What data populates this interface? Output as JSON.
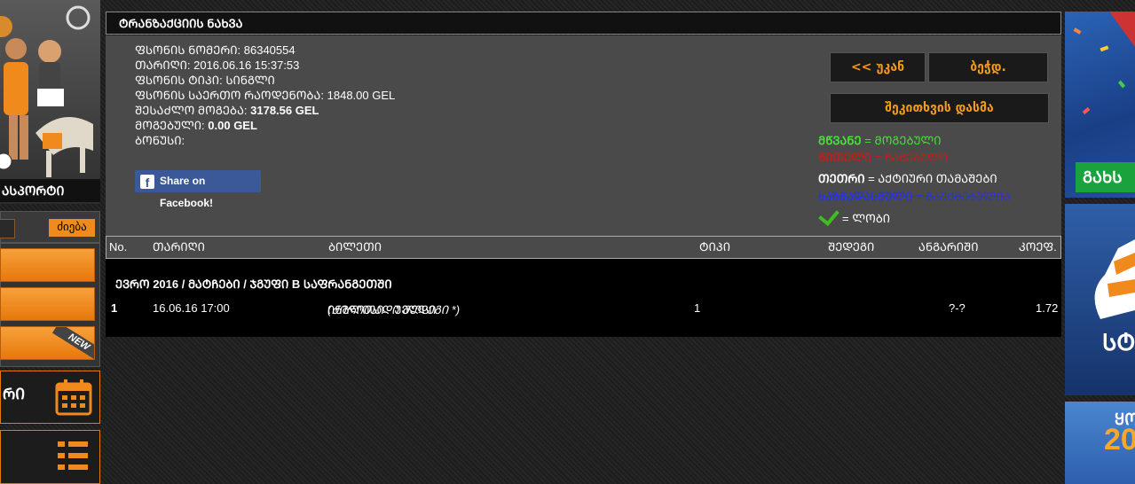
{
  "sidebar": {
    "sport_label": "ᲡᲞᲝᲠᲢᲘ",
    "sport_label_visible": "ᲐᲡᲞᲝᲠᲢᲘ",
    "search_button": "ძიება",
    "calendar_label": "ᲠᲘ",
    "new_badge": "NEW"
  },
  "panel": {
    "title": "ᲢᲠᲐᲜᲖᲐᲥᲪᲘᲘᲡ ᲜᲐᲮᲕᲐ",
    "info": {
      "ticket_number_label": "ᲤᲡᲝᲜᲘᲡ ᲜᲝᲛᲔᲠᲘ:",
      "ticket_number": "86340554",
      "date_label": "ᲗᲐᲠᲘᲦᲘ:",
      "date": "2016.06.16 15:37:53",
      "type_label": "ᲤᲡᲝᲜᲘᲡ ᲢᲘᲞᲘ:",
      "type": "ᲡᲘᲜᲒᲚᲘ",
      "total_label": "ᲤᲡᲝᲜᲘᲡ ᲡᲐᲔᲠᲗᲝ ᲠᲐᲝᲓᲔᲜᲝᲑᲐ:",
      "total": "1848.00 GEL",
      "possible_win_label": "ᲨᲔᲡᲐᲫᲚᲝ ᲛᲝᲒᲔᲑᲐ:",
      "possible_win": "3178.56 GEL",
      "won_label": "ᲛᲝᲒᲔᲑᲣᲚᲘ:",
      "won": "0.00 GEL",
      "bonus_label": "ᲑᲝᲜᲣᲡᲘ:"
    },
    "facebook_share": "Share on Facebook!",
    "back_button": "<< უკან",
    "print_button": "ბეჭდ.",
    "report_button": "შეკითხვის დასმა",
    "legend": [
      {
        "key": "ᲛᲬᲕᲐᲜᲔ",
        "value": "= ᲛᲝᲒᲔᲑᲣᲚᲘ",
        "color": "#4fdc3f"
      },
      {
        "key": "ᲬᲘᲗᲔᲚᲘ",
        "value": "= ᲬᲐᲒᲔᲑᲣᲚᲘ",
        "color": "#c21d1d"
      },
      {
        "key": "ᲗᲔᲗᲠᲘ",
        "value": "= ᲐᲥᲢᲘᲣᲠᲘ ᲗᲐᲛᲐᲨᲔᲑᲘ",
        "color": "#ffffff"
      },
      {
        "key": "ᲮᲐᲖᲒᲐᲓᲐᲡᲛᲣᲚᲘ",
        "value": "= ᲒᲐᲣᲥᲛᲔᲑᲣᲚᲘᲐ",
        "color": "#2a32e6"
      },
      {
        "key": "",
        "value": "= ᲚᲝᲑᲘ",
        "color": "#3dbf1f"
      }
    ],
    "table": {
      "headers": [
        "No.",
        "ᲗᲐᲠᲘᲦᲘ",
        "ᲑᲘᲚᲔᲗᲘ",
        "ᲢᲘᲞᲘ",
        "ᲨᲔᲓᲔᲒᲘ",
        "ᲐᲜᲒᲐᲠᲘᲨᲘ",
        "ᲙᲝᲔᲤ."
      ],
      "group": "ᲔᲕᲠᲝ 2016 / ᲛᲐᲢᲩᲔᲑᲘ / ᲯᲒᲣᲤᲘ B ᲡᲐᲤᲠᲐᲜᲒᲔᲗᲨᲘ",
      "rows": [
        {
          "no": "1",
          "date": "16.06.16 17:00",
          "ticket": "ᲘᲜᲒᲚᲘᲡᲘ - ᲣᲔᲚᲡᲘ",
          "ticket_note": "(ᲫᲘᲠᲘᲗᲐᲓᲘ ᲨᲔᲓᲔᲒᲘ *)",
          "type": "1",
          "result": "",
          "score": "?-?",
          "coef": "1.72"
        }
      ]
    }
  },
  "right_banners": {
    "banner1_button": "ᲒᲐᲮᲡ",
    "banner2_text": "ᲡᲢ",
    "banner3_line1": "ᲧᲝ",
    "banner3_line2": "20"
  }
}
